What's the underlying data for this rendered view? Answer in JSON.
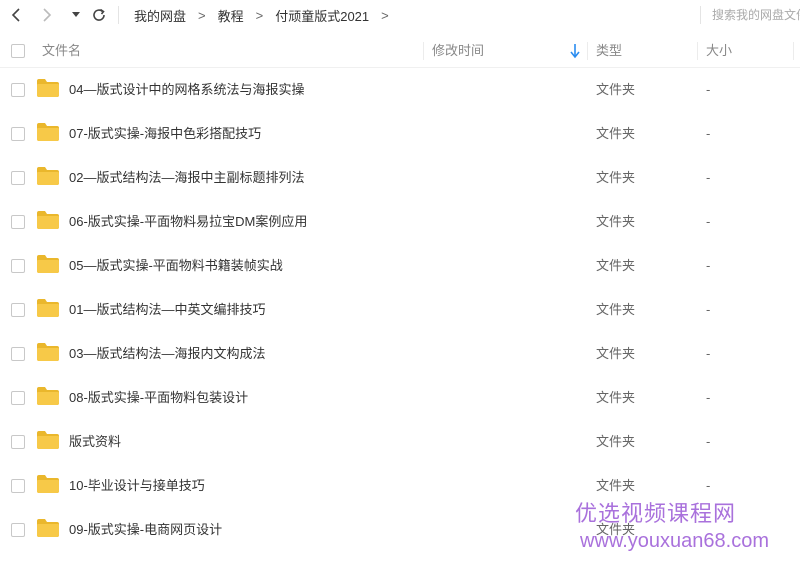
{
  "toolbar": {
    "breadcrumbs": [
      "我的网盘",
      "教程",
      "付顽童版式2021"
    ],
    "crumb_separator": ">",
    "search_placeholder": "搜索我的网盘文件"
  },
  "header": {
    "name": "文件名",
    "mtime": "修改时间",
    "type": "类型",
    "size": "大小"
  },
  "colors": {
    "folder": "#f7c948",
    "folder_dark": "#eab72c",
    "sort_arrow": "#2a8cf0",
    "watermark": "#9b59d6"
  },
  "files": [
    {
      "name": "04—版式设计中的网格系统法与海报实操",
      "mtime": "",
      "type": "文件夹",
      "size": "-"
    },
    {
      "name": "07-版式实操-海报中色彩搭配技巧",
      "mtime": "",
      "type": "文件夹",
      "size": "-"
    },
    {
      "name": "02—版式结构法—海报中主副标题排列法",
      "mtime": "",
      "type": "文件夹",
      "size": "-"
    },
    {
      "name": "06-版式实操-平面物料易拉宝DM案例应用",
      "mtime": "",
      "type": "文件夹",
      "size": "-"
    },
    {
      "name": "05—版式实操-平面物料书籍装帧实战",
      "mtime": "",
      "type": "文件夹",
      "size": "-"
    },
    {
      "name": "01—版式结构法—中英文编排技巧",
      "mtime": "",
      "type": "文件夹",
      "size": "-"
    },
    {
      "name": "03—版式结构法—海报内文构成法",
      "mtime": "",
      "type": "文件夹",
      "size": "-"
    },
    {
      "name": "08-版式实操-平面物料包装设计",
      "mtime": "",
      "type": "文件夹",
      "size": "-"
    },
    {
      "name": "版式资料",
      "mtime": "",
      "type": "文件夹",
      "size": "-"
    },
    {
      "name": "10-毕业设计与接单技巧",
      "mtime": "",
      "type": "文件夹",
      "size": "-"
    },
    {
      "name": "09-版式实操-电商网页设计",
      "mtime": "",
      "type": "文件夹",
      "size": ""
    }
  ],
  "watermark": {
    "line1": "优选视频课程网",
    "line2": "www.youxuan68.com"
  }
}
